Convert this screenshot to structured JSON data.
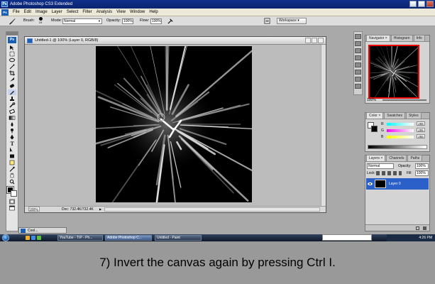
{
  "app": {
    "title": "Adobe Photoshop CS3 Extended",
    "logo_text": "Ps"
  },
  "menu": [
    "File",
    "Edit",
    "Image",
    "Layer",
    "Select",
    "Filter",
    "Analysis",
    "View",
    "Window",
    "Help"
  ],
  "options": {
    "brush_label": "Brush:",
    "brush_size": "19",
    "mode_label": "Mode:",
    "mode_value": "Normal",
    "opacity_label": "Opacity:",
    "opacity_value": "100%",
    "flow_label": "Flow:",
    "flow_value": "100%",
    "workspace_label": "Workspace ▾"
  },
  "document": {
    "title": "Untitled-1 @ 100% (Layer 0, RGB/8)",
    "zoom": "100%",
    "doc_size": "Doc: 732.4K/732.4K"
  },
  "navigator": {
    "tabs": [
      "Navigator ×",
      "Histogram",
      "Info"
    ],
    "zoom": "100%"
  },
  "color": {
    "tabs": [
      "Color ×",
      "Swatches",
      "Styles"
    ],
    "channels": [
      {
        "label": "R",
        "value": "255",
        "color": "#ff2020"
      },
      {
        "label": "G",
        "value": "255",
        "color": "#20c020"
      },
      {
        "label": "B",
        "value": "255",
        "color": "#2040ff"
      }
    ]
  },
  "layers": {
    "tabs": [
      "Layers ×",
      "Channels",
      "Paths"
    ],
    "blend_mode": "Normal",
    "opacity_label": "Opacity:",
    "opacity_value": "100%",
    "lock_label": "Lock:",
    "fill_label": "Fill:",
    "fill_value": "100%",
    "layer_name": "Layer 0"
  },
  "taskbar": {
    "tasks": [
      {
        "label": "YouTube - TIP - Ph...",
        "active": false
      },
      {
        "label": "Adobe Photoshop C...",
        "active": true
      },
      {
        "label": "Untitled - Paint",
        "active": false
      }
    ],
    "time": "4:26 PM",
    "dock_label": "Cool..."
  },
  "caption": "7) Invert the canvas again by pressing Ctrl I."
}
